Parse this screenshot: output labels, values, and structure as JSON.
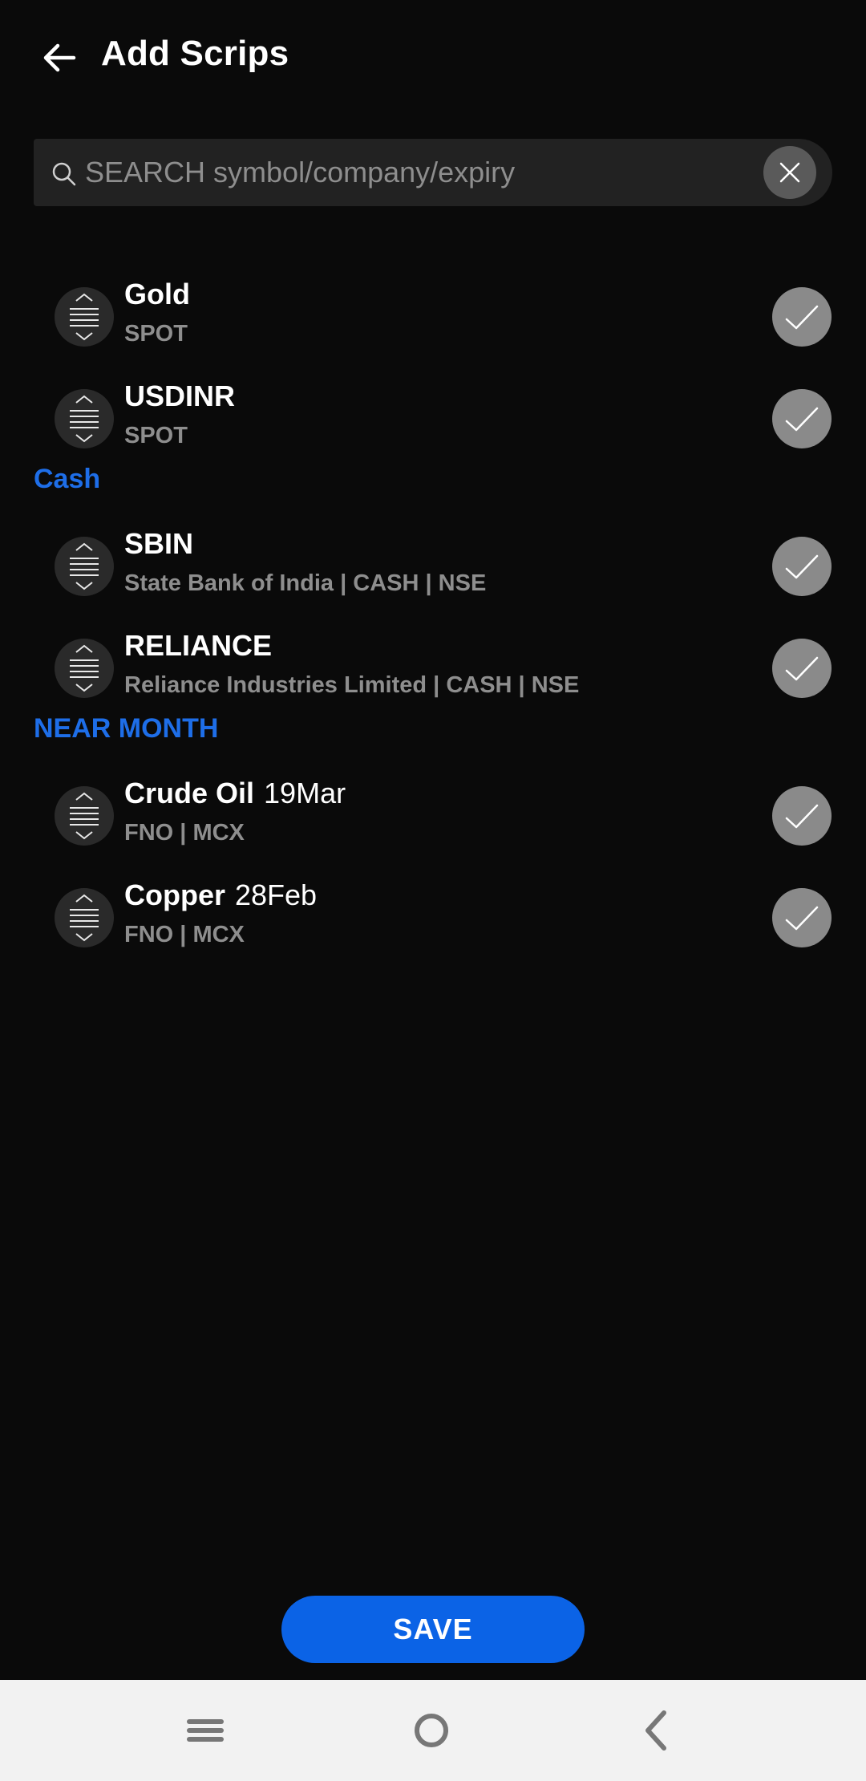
{
  "header": {
    "title": "Add Scrips",
    "back_icon": "arrow-left-icon"
  },
  "search": {
    "placeholder": "SEARCH symbol/company/expiry",
    "value": "",
    "clear_icon": "close-icon"
  },
  "groups": [
    {
      "label": "",
      "items": [
        {
          "symbol": "Gold",
          "expiry": "",
          "subtitle": "SPOT",
          "selected": true
        },
        {
          "symbol": "USDINR",
          "expiry": "",
          "subtitle": "SPOT",
          "selected": true
        }
      ]
    },
    {
      "label": "Cash",
      "items": [
        {
          "symbol": "SBIN",
          "expiry": "",
          "subtitle": "State Bank of India | CASH | NSE",
          "selected": true
        },
        {
          "symbol": "RELIANCE",
          "expiry": "",
          "subtitle": "Reliance Industries Limited | CASH | NSE",
          "selected": true
        }
      ]
    },
    {
      "label": "NEAR MONTH",
      "items": [
        {
          "symbol": "Crude Oil",
          "expiry": "19Mar",
          "subtitle": "FNO | MCX",
          "selected": true
        },
        {
          "symbol": "Copper",
          "expiry": "28Feb",
          "subtitle": "FNO | MCX",
          "selected": true
        }
      ]
    }
  ],
  "save_label": "SAVE",
  "navbar": {
    "recents_icon": "recents-icon",
    "home_icon": "home-circle-icon",
    "back_icon": "chevron-left-icon"
  },
  "colors": {
    "accent": "#0b63e6",
    "section": "#1e6ee8",
    "background": "#0a0a0a",
    "check": "#8a8a8a"
  }
}
